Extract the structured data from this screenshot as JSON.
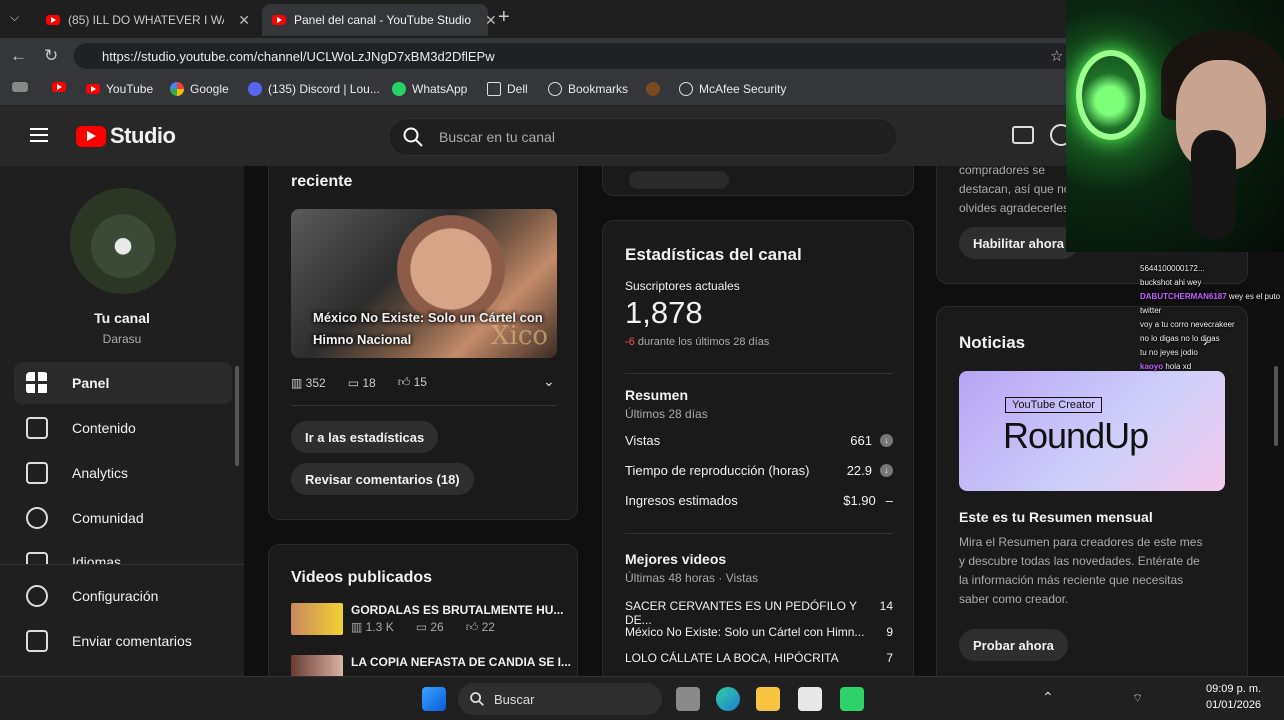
{
  "browser": {
    "tabs": [
      {
        "label": "(85) ILL DO WHATEVER I WANT W",
        "active": false
      },
      {
        "label": "Panel del canal - YouTube Studio",
        "active": true
      }
    ],
    "new_tab": "+",
    "url": "https://studio.youtube.com/channel/UCLWoLzJNgD7xBM3d2DflEPw",
    "bookmarks": [
      "YouTube",
      "Google",
      "(135) Discord | Lou...",
      "WhatsApp",
      "Dell",
      "Bookmarks",
      "McAfee Security"
    ]
  },
  "studio": {
    "logo_text": "Studio",
    "search_placeholder": "Buscar en tu canal"
  },
  "sidebar": {
    "channel_title": "Tu canal",
    "channel_handle": "Darasu",
    "items": [
      {
        "label": "Panel",
        "icon": "dashboard-icon",
        "active": true
      },
      {
        "label": "Contenido",
        "icon": "content-icon"
      },
      {
        "label": "Analytics",
        "icon": "analytics-icon"
      },
      {
        "label": "Comunidad",
        "icon": "community-icon"
      },
      {
        "label": "Idiomas",
        "icon": "subtitles-icon"
      }
    ],
    "bottom": [
      {
        "label": "Configuración",
        "icon": "gear-icon"
      },
      {
        "label": "Enviar comentarios",
        "icon": "feedback-icon"
      }
    ]
  },
  "latest_video": {
    "heading": "reciente",
    "title": "México No Existe: Solo un Cártel con Himno Nacional",
    "thumb_watermark": "Xico",
    "views": "352",
    "comments": "18",
    "likes": "15",
    "btn_stats": "Ir a las estadísticas",
    "btn_comments": "Revisar comentarios (18)"
  },
  "published": {
    "heading": "Videos publicados",
    "videos": [
      {
        "title": "GORDALAS ES BRUTALMENTE HU...",
        "views": "1.3 K",
        "comments": "26",
        "likes": "22"
      },
      {
        "title": "LA COPIA NEFASTA DE CANDIA SE I..."
      }
    ]
  },
  "channel_stats": {
    "heading": "Estadísticas del canal",
    "subs_label": "Suscriptores actuales",
    "subs_value": "1,878",
    "delta": "-6",
    "delta_text": "durante los últimos 28 días",
    "summary_title": "Resumen",
    "summary_sub": "Últimos 28 días",
    "rows": [
      {
        "label": "Vistas",
        "value": "661",
        "trend": "down"
      },
      {
        "label": "Tiempo de reproducción (horas)",
        "value": "22.9",
        "trend": "down"
      },
      {
        "label": "Ingresos estimados",
        "value": "$1.90",
        "trend": "flat"
      }
    ],
    "top_title": "Mejores videos",
    "top_sub": "Últimas 48 horas · Vistas",
    "top_videos": [
      {
        "title": "SACER CERVANTES ES UN PEDÓFILO Y DE...",
        "value": "14"
      },
      {
        "title": "México No Existe: Solo un Cártel con Himn...",
        "value": "9"
      },
      {
        "title": "LOLO CÁLLATE LA BOCA, HIPÓCRITA",
        "value": "7"
      }
    ]
  },
  "right_col": {
    "promo_text": [
      "compradores se",
      "destacan, así que no",
      "olvides agradecerles"
    ],
    "btn_enable": "Habilitar ahora",
    "news_heading": "Noticias",
    "news_banner_tag": "YouTube Creator",
    "news_banner_title": "RoundUp",
    "news_title": "Este es tu Resumen mensual",
    "news_body": "Mira el Resumen para creadores de este mes y descubre todas las novedades. Entérate de la información más reciente que necesitas saber como creador.",
    "btn_try": "Probar ahora"
  },
  "taskbar": {
    "search": "Buscar",
    "time": "09:09 p. m.",
    "date": "01/01/2026"
  },
  "stream_chat": [
    {
      "name": "",
      "text": "5644100000172..."
    },
    {
      "name": "",
      "text": "buckshot ahi wey"
    },
    {
      "name": "DABUTCHERMAN6187",
      "text": "wey es el puto twitter"
    },
    {
      "name": "",
      "text": "voy a tu corro nevecrakeer"
    },
    {
      "name": "",
      "text": "no lo digas no lo digas"
    },
    {
      "name": "",
      "text": "tu no jeyes jodio"
    },
    {
      "name": "kaoyo",
      "text": "hola xd"
    }
  ]
}
